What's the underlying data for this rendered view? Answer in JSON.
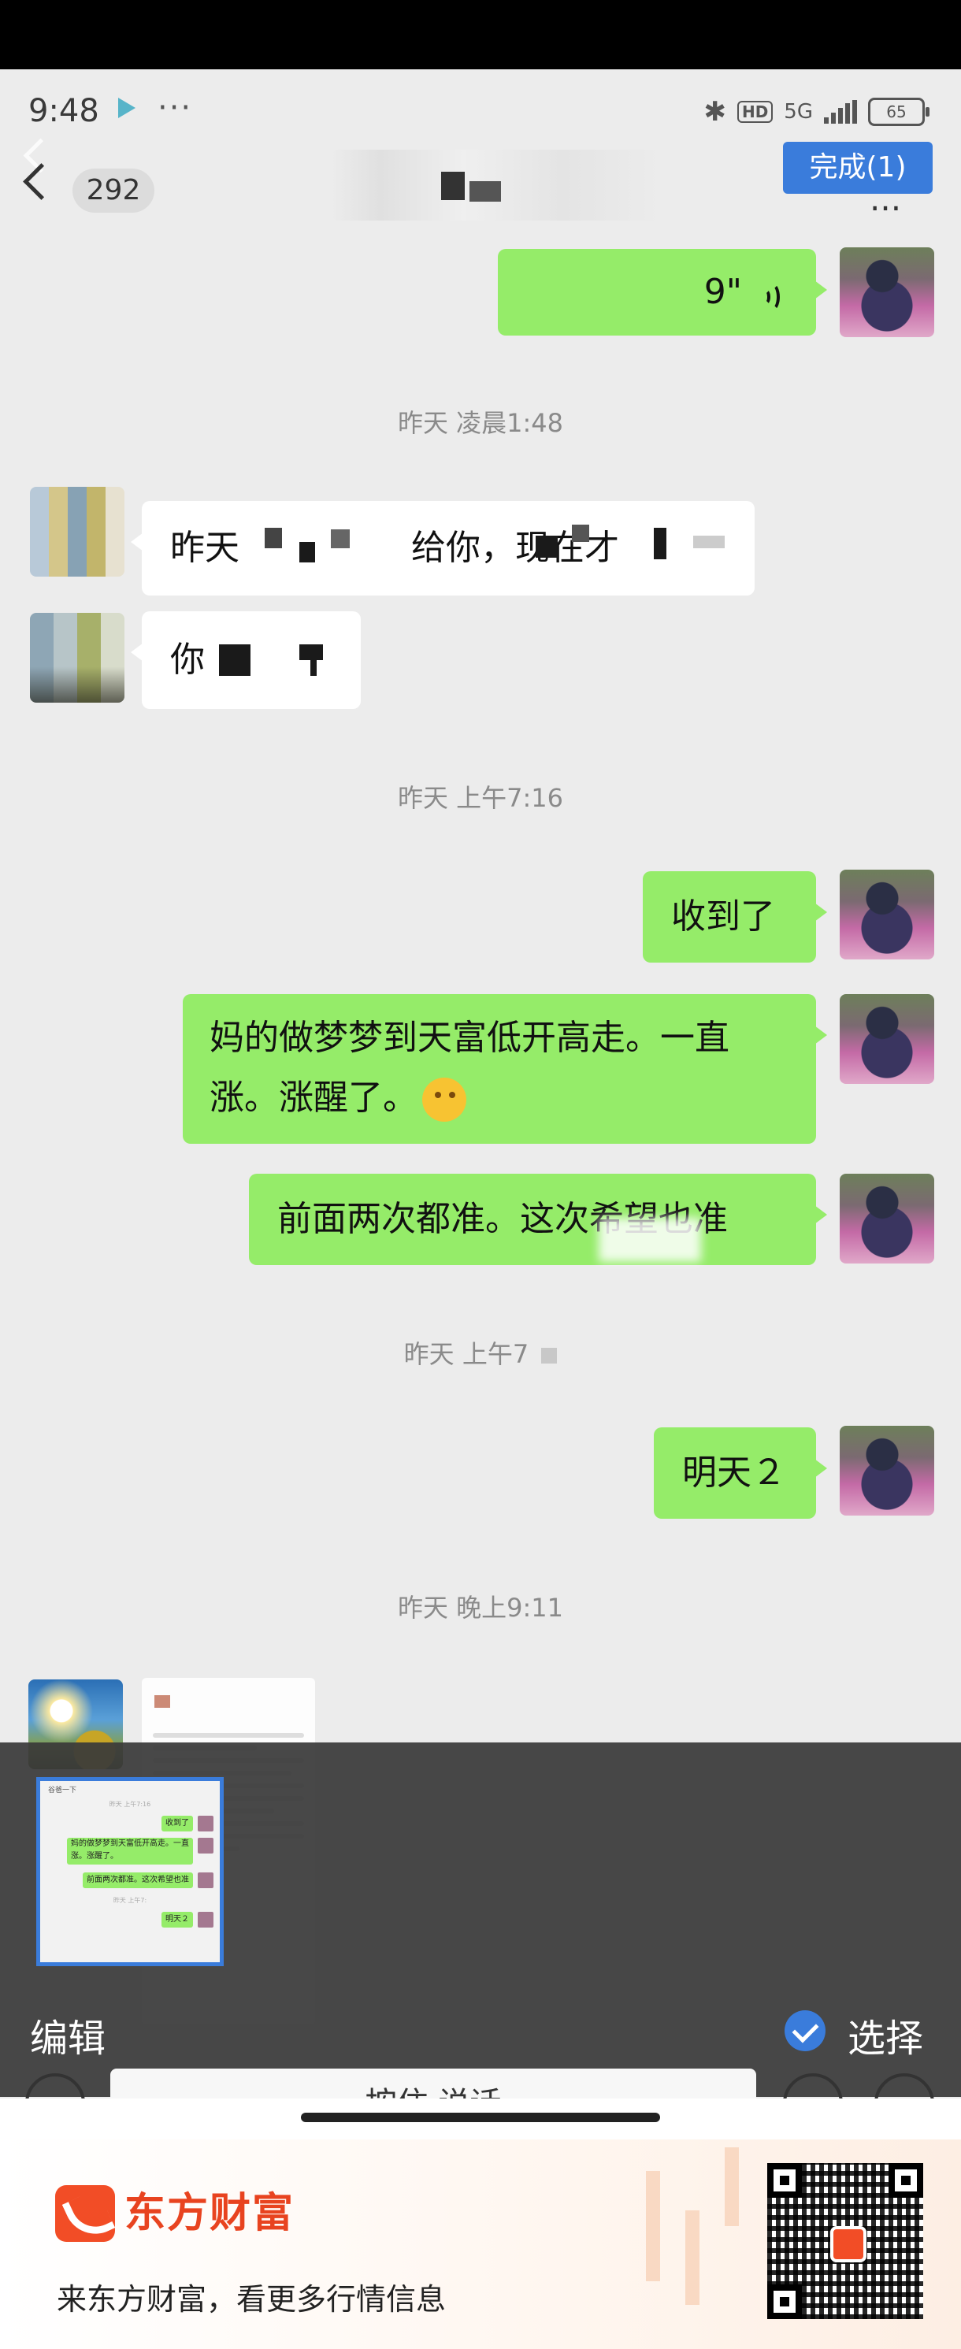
{
  "status_bar": {
    "time": "9:48",
    "dots": "···",
    "hd": "HD",
    "network": "5G",
    "battery": "65"
  },
  "header": {
    "unread_count": "292",
    "done_label": "完成(1)",
    "more": "···"
  },
  "messages": {
    "voice_duration": "9\"",
    "ts1": "昨天 凌晨1:48",
    "other_msg1": "昨天",
    "other_msg1_mid": "给你，现在才",
    "other_msg2": "你",
    "ts2": "昨天 上午7:16",
    "me_msg1": "收到了",
    "me_msg2_line1": "妈的做梦梦到天富低开高走。一直",
    "me_msg2_line2": "涨。涨醒了。",
    "me_msg3": "前面两次都准。这次希望也准",
    "ts3": "昨天 上午7",
    "me_msg4": "明天２",
    "ts4": "昨天 晚上9:11"
  },
  "thumbnail": {
    "title": "谷爸一下",
    "ts_a": "昨天 上午7:16",
    "m1": "收到了",
    "m2a": "妈的做梦梦到天富低开高走。一直",
    "m2b": "涨。涨醒了。",
    "m3": "前面两次都准。这次希望也准",
    "ts_b": "昨天 上午7:",
    "m4": "明天２"
  },
  "overlay": {
    "edit_label": "编辑",
    "select_label": "选择"
  },
  "input_bar": {
    "hold_to_talk": "按住 说话"
  },
  "ad": {
    "brand": "东方财富",
    "slogan": "来东方财富，看更多行情信息"
  },
  "colors": {
    "green_bubble": "#95ec69",
    "accent_blue": "#3a7cdb",
    "brand_orange": "#f24d26"
  }
}
